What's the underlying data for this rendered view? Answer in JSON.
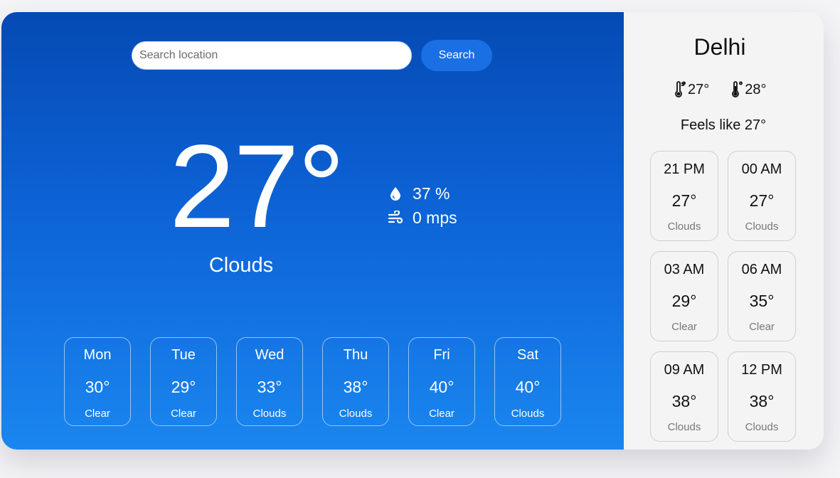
{
  "search": {
    "placeholder": "Search location",
    "button_label": "Search"
  },
  "current": {
    "temperature": "27°",
    "condition": "Clouds",
    "humidity": "37 %",
    "wind": "0 mps"
  },
  "daily": [
    {
      "day": "Mon",
      "temp": "30°",
      "condition": "Clear"
    },
    {
      "day": "Tue",
      "temp": "29°",
      "condition": "Clear"
    },
    {
      "day": "Wed",
      "temp": "33°",
      "condition": "Clouds"
    },
    {
      "day": "Thu",
      "temp": "38°",
      "condition": "Clouds"
    },
    {
      "day": "Fri",
      "temp": "40°",
      "condition": "Clear"
    },
    {
      "day": "Sat",
      "temp": "40°",
      "condition": "Clouds"
    }
  ],
  "sidebar": {
    "city": "Delhi",
    "min_temp": "27°",
    "max_temp": "28°",
    "feels_like": "Feels like 27°",
    "hourly": [
      {
        "time": "21 PM",
        "temp": "27°",
        "condition": "Clouds"
      },
      {
        "time": "00 AM",
        "temp": "27°",
        "condition": "Clouds"
      },
      {
        "time": "03 AM",
        "temp": "29°",
        "condition": "Clear"
      },
      {
        "time": "06 AM",
        "temp": "35°",
        "condition": "Clear"
      },
      {
        "time": "09 AM",
        "temp": "38°",
        "condition": "Clouds"
      },
      {
        "time": "12 PM",
        "temp": "38°",
        "condition": "Clouds"
      }
    ]
  },
  "icons": {
    "humidity": "water-drop-icon",
    "wind": "wind-icon",
    "min_temp": "thermometer-low-icon",
    "max_temp": "thermometer-high-icon"
  },
  "colors": {
    "gradient_top": "#054ab4",
    "gradient_bottom": "#1a86f0",
    "search_button": "#1b6fe4",
    "sidebar_bg": "#f4f4f4"
  }
}
